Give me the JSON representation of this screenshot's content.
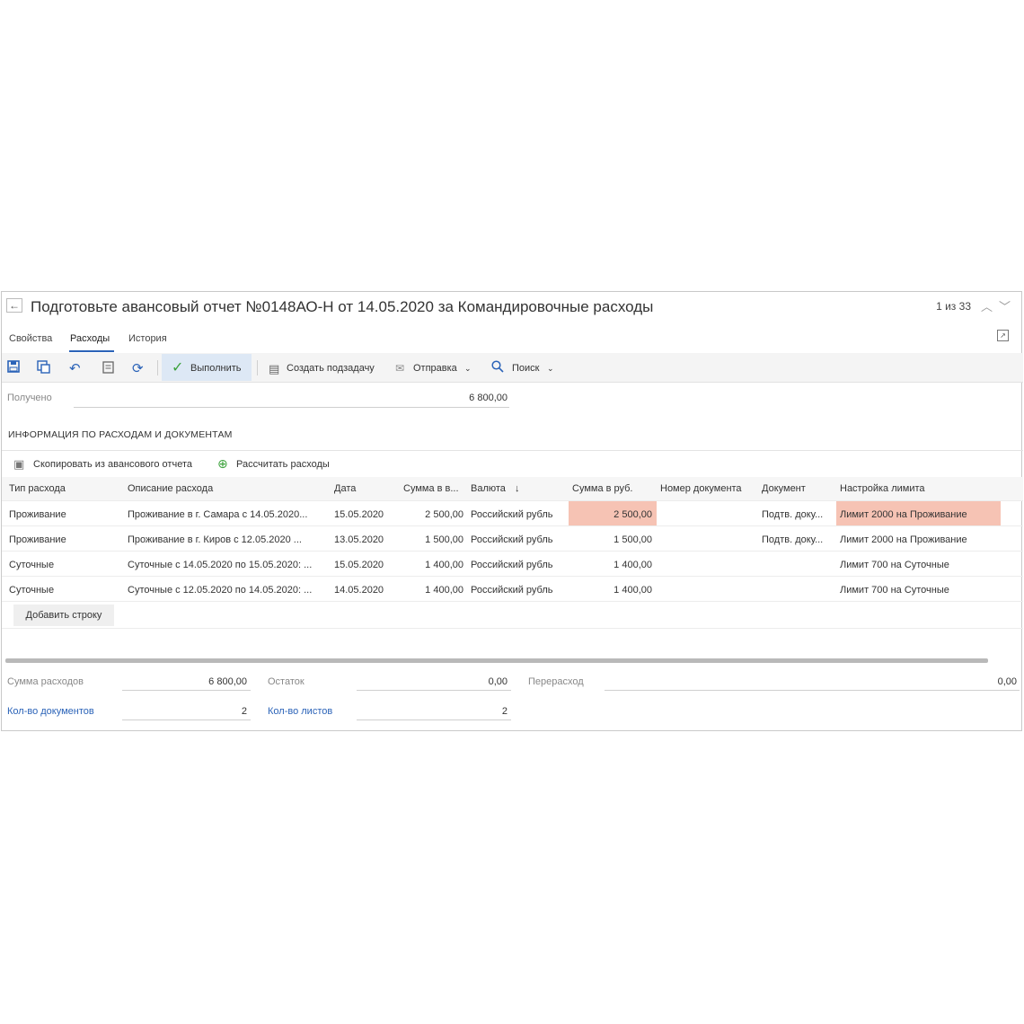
{
  "header": {
    "title": "Подготовьте авансовый отчет №0148АО-Н от 14.05.2020 за Командировочные расходы",
    "pager": "1 из 33"
  },
  "tabs": [
    "Свойства",
    "Расходы",
    "История"
  ],
  "toolbar": {
    "run": "Выполнить",
    "create_subtask": "Создать подзадачу",
    "send": "Отправка",
    "search": "Поиск"
  },
  "received": {
    "label": "Получено",
    "value": "6 800,00"
  },
  "section_title": "ИНФОРМАЦИЯ ПО РАСХОДАМ И ДОКУМЕНТАМ",
  "sub_toolbar": {
    "copy": "Скопировать из авансового отчета",
    "calc": "Рассчитать расходы"
  },
  "table": {
    "columns": [
      "Тип расхода",
      "Описание расхода",
      "Дата",
      "Сумма в в...",
      "Валюта",
      "Сумма в руб.",
      "Номер документа",
      "Документ",
      "Настройка лимита"
    ],
    "sort_marker": "↓",
    "rows": [
      {
        "type": "Проживание",
        "desc": "Проживание в г. Самара с 14.05.2020...",
        "date": "15.05.2020",
        "sum_cur": "2 500,00",
        "currency": "Российский рубль",
        "sum_rub": "2 500,00",
        "doc_no": "",
        "doc": "Подтв. доку...",
        "limit": "Лимит 2000 на Проживание"
      },
      {
        "type": "Проживание",
        "desc": "Проживание в г. Киров с 12.05.2020 ...",
        "date": "13.05.2020",
        "sum_cur": "1 500,00",
        "currency": "Российский рубль",
        "sum_rub": "1 500,00",
        "doc_no": "",
        "doc": "Подтв. доку...",
        "limit": "Лимит 2000 на Проживание"
      },
      {
        "type": "Суточные",
        "desc": "Суточные с 14.05.2020 по 15.05.2020: ...",
        "date": "15.05.2020",
        "sum_cur": "1 400,00",
        "currency": "Российский рубль",
        "sum_rub": "1 400,00",
        "doc_no": "",
        "doc": "",
        "limit": "Лимит 700 на Суточные"
      },
      {
        "type": "Суточные",
        "desc": "Суточные с 12.05.2020 по 14.05.2020: ...",
        "date": "14.05.2020",
        "sum_cur": "1 400,00",
        "currency": "Российский рубль",
        "sum_rub": "1 400,00",
        "doc_no": "",
        "doc": "",
        "limit": "Лимит 700 на Суточные"
      }
    ],
    "add_row": "Добавить строку"
  },
  "totals": {
    "expenses_label": "Сумма расходов",
    "expenses_value": "6 800,00",
    "rest_label": "Остаток",
    "rest_value": "0,00",
    "over_label": "Перерасход",
    "over_value": "0,00",
    "docs_label": "Кол-во документов",
    "docs_value": "2",
    "sheets_label": "Кол-во листов",
    "sheets_value": "2"
  },
  "colors": {
    "accent": "#2b63b8",
    "warning": "#f6c3b4",
    "ok": "#3ca23c"
  }
}
